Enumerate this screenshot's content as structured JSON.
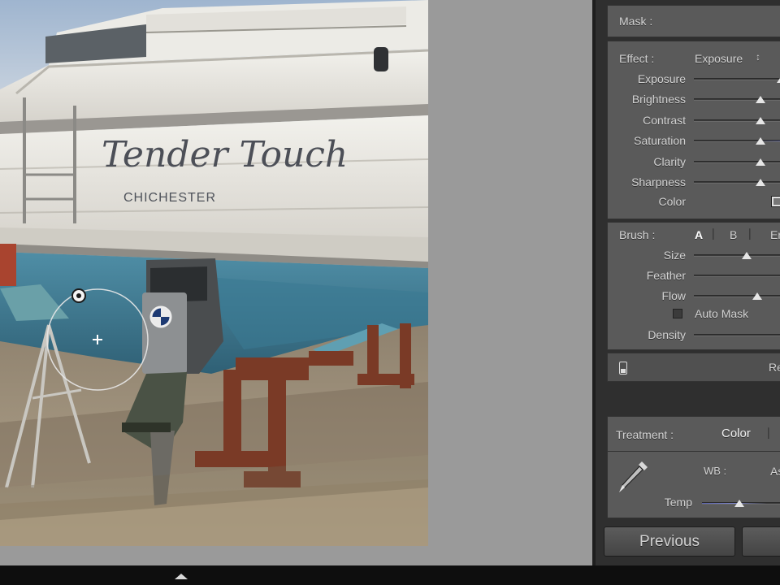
{
  "photo": {
    "boat_name": "Tender Touch",
    "home_port": "CHICHESTER",
    "outboard_badge": "BMW"
  },
  "mask": {
    "label": "Mask :"
  },
  "effect": {
    "label": "Effect :",
    "preset": "Exposure",
    "preset_arrow": "↕",
    "sliders": [
      {
        "label": "Exposure",
        "value": 0.78
      },
      {
        "label": "Brightness",
        "value": 0.62
      },
      {
        "label": "Contrast",
        "value": 0.62
      },
      {
        "label": "Saturation",
        "value": 0.62
      },
      {
        "label": "Clarity",
        "value": 0.62
      },
      {
        "label": "Sharpness",
        "value": 0.62
      }
    ],
    "color_label": "Color"
  },
  "brush": {
    "label": "Brush :",
    "option_a": "A",
    "option_b": "B",
    "option_erase": "Er",
    "sliders": [
      {
        "label": "Size",
        "value": 0.52
      },
      {
        "label": "Feather",
        "value": null
      },
      {
        "label": "Flow",
        "value": 0.6
      }
    ],
    "auto_mask_label": "Auto Mask",
    "auto_mask_checked": false,
    "density_label": "Density",
    "reset_label": "Re"
  },
  "basic": {
    "treatment_label": "Treatment :",
    "treatment_value": "Color",
    "wb_label": "WB :",
    "wb_value": "As",
    "temp_label": "Temp",
    "temp_value": 0.42
  },
  "buttons": {
    "previous": "Previous"
  },
  "colors": {
    "panel_bg": "#2f2f2f",
    "section_bg": "#5a5a5a",
    "label_text": "#d2d2d2",
    "active_option": "#ffffff",
    "temp_track": "#5a63b0"
  }
}
